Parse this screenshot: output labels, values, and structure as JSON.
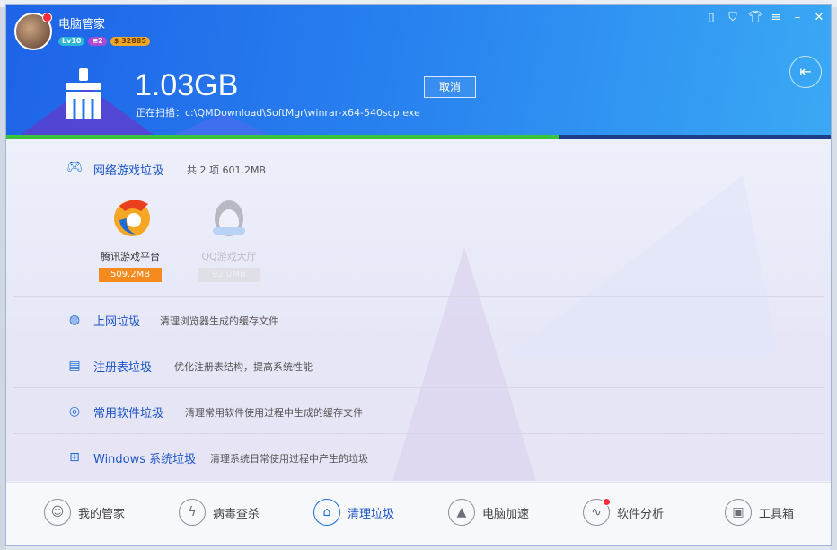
{
  "header": {
    "app_title": "电脑管家",
    "badges": {
      "level": "Lv10",
      "vip": "≡2",
      "coins": "$ 32885"
    },
    "scan_size": "1.03GB",
    "scan_status": "正在扫描：c:\\QMDownload\\SoftMgr\\winrar-x64-540scp.exe",
    "cancel_label": "取消",
    "progress": 0.67,
    "top_controls": [
      "phone-icon",
      "shield-icon",
      "shirt-icon",
      "menu-icon",
      "minimize-icon",
      "close-icon"
    ]
  },
  "sections": {
    "game": {
      "name": "网络游戏垃圾",
      "summary": "共 2 项 601.2MB"
    },
    "tiles": [
      {
        "label": "腾讯游戏平台",
        "size": "509.2MB"
      },
      {
        "label": "QQ游戏大厅",
        "size": "92.0MB"
      }
    ],
    "web": {
      "name": "上网垃圾",
      "desc": "清理浏览器生成的缓存文件"
    },
    "registry": {
      "name": "注册表垃圾",
      "desc": "优化注册表结构，提高系统性能"
    },
    "software": {
      "name": "常用软件垃圾",
      "desc": "清理常用软件使用过程中生成的缓存文件"
    },
    "windows": {
      "name": "Windows 系统垃圾",
      "desc": "清理系统日常使用过程中产生的垃圾"
    }
  },
  "bottom_nav": [
    {
      "label": "我的管家",
      "icon": "butler-icon"
    },
    {
      "label": "病毒查杀",
      "icon": "lightning-icon"
    },
    {
      "label": "清理垃圾",
      "icon": "cleanup-icon"
    },
    {
      "label": "电脑加速",
      "icon": "rocket-icon"
    },
    {
      "label": "软件分析",
      "icon": "analysis-icon"
    },
    {
      "label": "工具箱",
      "icon": "toolbox-icon"
    }
  ],
  "colors": {
    "accent": "#1c55c8",
    "progress": "#3bc53f",
    "tile_size": "#f58a1f"
  }
}
